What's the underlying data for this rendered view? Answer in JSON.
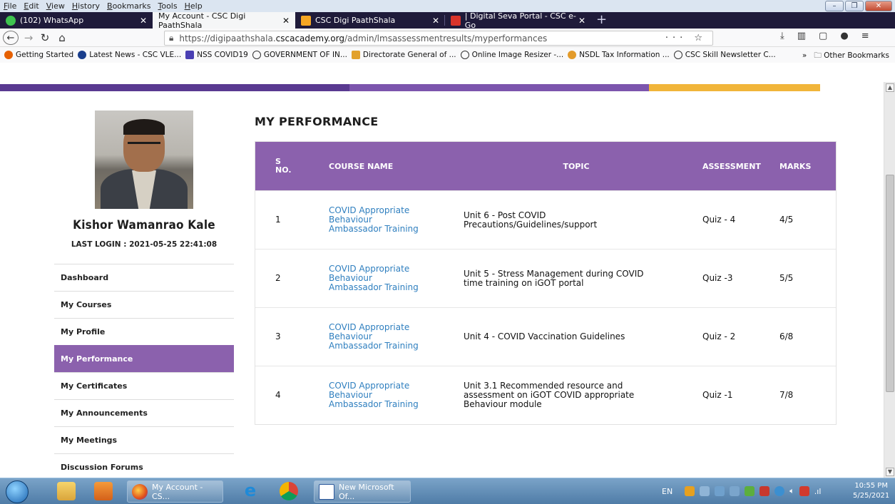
{
  "menubar": {
    "items": [
      "File",
      "Edit",
      "View",
      "History",
      "Bookmarks",
      "Tools",
      "Help"
    ]
  },
  "tabs": [
    {
      "label": "(102) WhatsApp"
    },
    {
      "label": "My Account - CSC Digi PaathShala"
    },
    {
      "label": "CSC Digi PaathShala"
    },
    {
      "label": "| Digital Seva Portal - CSC e-Go"
    }
  ],
  "urlbar": {
    "prefix": "https://digipaathshala.",
    "host": "cscacademy.org",
    "path": "/admin/lmsassessmentresults/myperformances"
  },
  "bookmarks": {
    "items": [
      "Getting Started",
      "Latest News - CSC VLE...",
      "NSS COVID19",
      "GOVERNMENT OF IN...",
      "Directorate General of ...",
      "Online Image Resizer -...",
      "NSDL Tax Information ...",
      "CSC Skill Newsletter C..."
    ],
    "overflow": "»",
    "other": "Other Bookmarks"
  },
  "profile": {
    "name": "Kishor Wamanrao Kale",
    "last_login": "LAST LOGIN : 2021-05-25 22:41:08"
  },
  "sidenav": {
    "items": [
      {
        "label": "Dashboard"
      },
      {
        "label": "My Courses"
      },
      {
        "label": "My Profile"
      },
      {
        "label": "My Performance"
      },
      {
        "label": "My Certificates"
      },
      {
        "label": "My Announcements"
      },
      {
        "label": "My Meetings"
      },
      {
        "label": "Discussion Forums"
      }
    ]
  },
  "page": {
    "title": "MY PERFORMANCE"
  },
  "table": {
    "headers": {
      "sno_1": "S",
      "sno_2": "NO.",
      "course": "COURSE NAME",
      "topic": "TOPIC",
      "assessment": "ASSESSMENT",
      "marks": "MARKS"
    },
    "rows": [
      {
        "sno": "1",
        "course_1": "COVID Appropriate",
        "course_2": "Behaviour",
        "course_3": "Ambassador Training",
        "topic_1": "Unit 6 - Post COVID",
        "topic_2": "Precautions/Guidelines/support",
        "topic_3": "",
        "assessment": "Quiz - 4",
        "marks": "4/5"
      },
      {
        "sno": "2",
        "course_1": "COVID Appropriate",
        "course_2": "Behaviour",
        "course_3": "Ambassador Training",
        "topic_1": "Unit 5 - Stress Management during COVID",
        "topic_2": "time training on iGOT portal",
        "topic_3": "",
        "assessment": "Quiz -3",
        "marks": "5/5"
      },
      {
        "sno": "3",
        "course_1": "COVID Appropriate",
        "course_2": "Behaviour",
        "course_3": "Ambassador Training",
        "topic_1": "Unit 4 - COVID Vaccination Guidelines",
        "topic_2": "",
        "topic_3": "",
        "assessment": "Quiz - 2",
        "marks": "6/8"
      },
      {
        "sno": "4",
        "course_1": "COVID Appropriate",
        "course_2": "Behaviour",
        "course_3": "Ambassador Training",
        "topic_1": "Unit 3.1 Recommended resource and",
        "topic_2": "assessment on iGOT COVID appropriate",
        "topic_3": "Behaviour module",
        "assessment": "Quiz -1",
        "marks": "7/8"
      }
    ]
  },
  "taskbar": {
    "firefox_task": "My Account - CS...",
    "word_task": "New Microsoft Of...",
    "lang": "EN",
    "time": "10:55 PM",
    "date": "5/25/2021"
  },
  "colors": {
    "accent_purple": "#8b61ad",
    "link_blue": "#2f7fbf",
    "tab_strip": "#1f1b3a"
  }
}
